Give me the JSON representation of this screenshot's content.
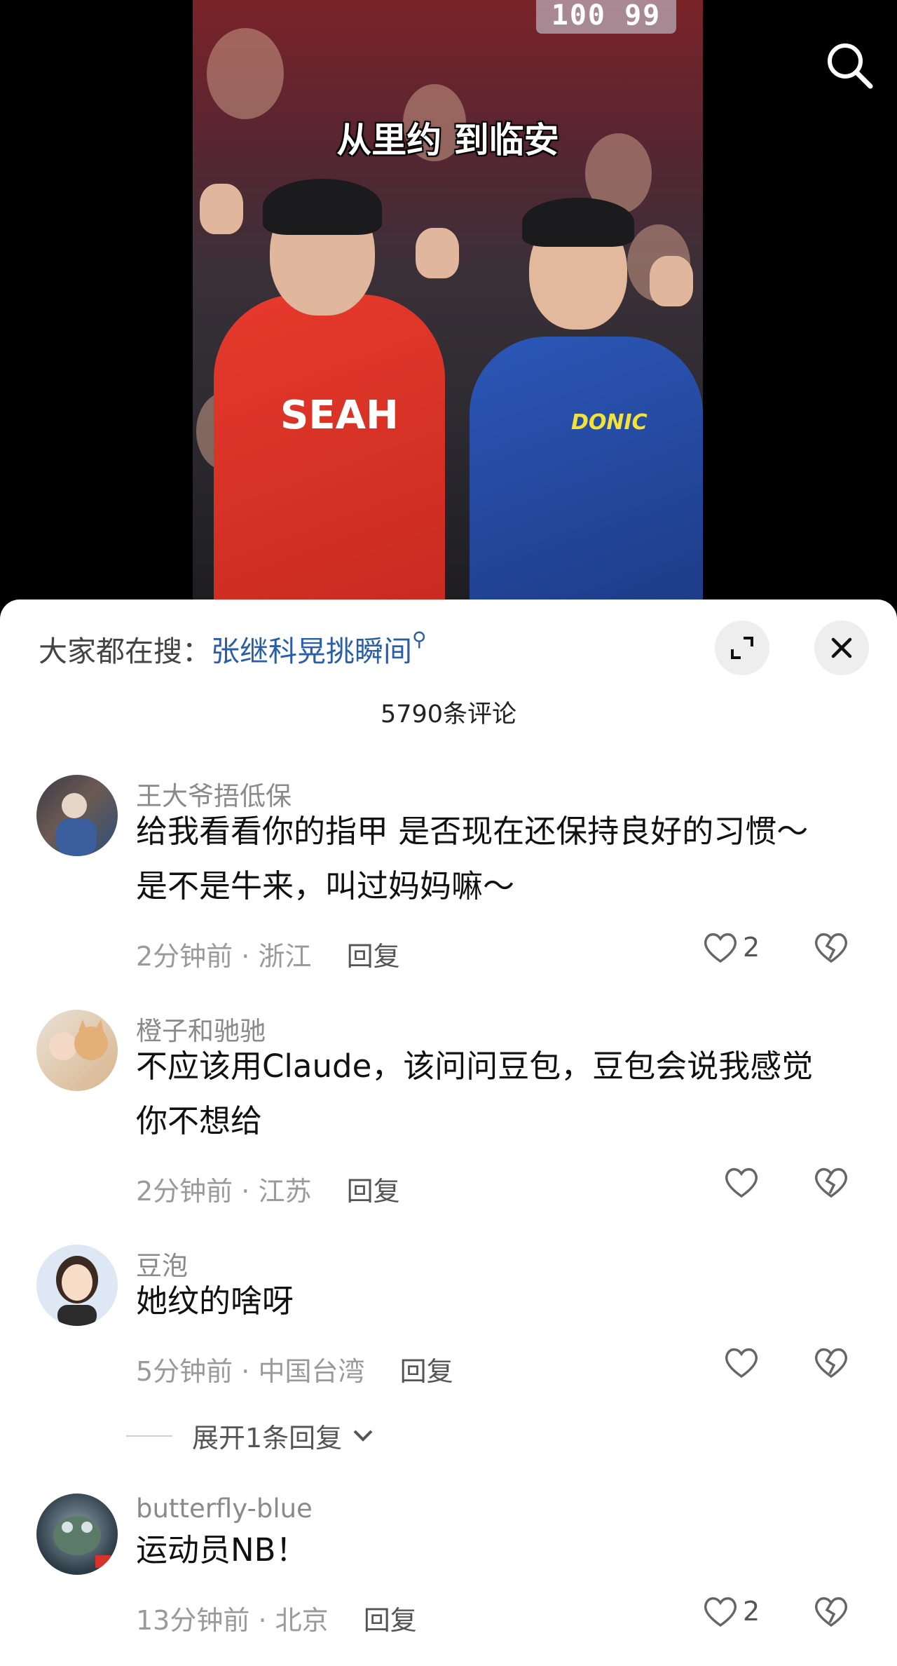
{
  "video": {
    "caption": "从里约 到临安",
    "scoreboard": "100 99",
    "jersey_red": "SEAH",
    "jersey_blue": "DONIC"
  },
  "sheet": {
    "hot_search_label": "大家都在搜：",
    "hot_search_term": "张继科晃挑瞬间",
    "comment_count": "5790条评论",
    "expand_icon": "expand-icon",
    "close_icon": "close-icon"
  },
  "comments": [
    {
      "user": "王大爷捂低保",
      "text_line1": "给我看看你的指甲 是否现在还保持良好的习惯～",
      "text_line2": "是不是牛来，叫过妈妈嘛～",
      "time": "2分钟前",
      "location": "浙江",
      "reply_label": "回复",
      "likes": "2"
    },
    {
      "user": "橙子和驰驰",
      "text_line1": "不应该用Claude，该问问豆包，豆包会说我感觉",
      "text_line2": "你不想给",
      "time": "2分钟前",
      "location": "江苏",
      "reply_label": "回复",
      "likes": ""
    },
    {
      "user": "豆泡",
      "text_line1": "她纹的啥呀",
      "time": "5分钟前",
      "location": "中国台湾",
      "reply_label": "回复",
      "likes": ""
    },
    {
      "user": "butterfly-blue",
      "text_line1": "运动员NB！",
      "time": "13分钟前",
      "location": "北京",
      "reply_label": "回复",
      "likes": "2"
    }
  ],
  "expand_replies_label": "展开1条回复",
  "separator": "·"
}
